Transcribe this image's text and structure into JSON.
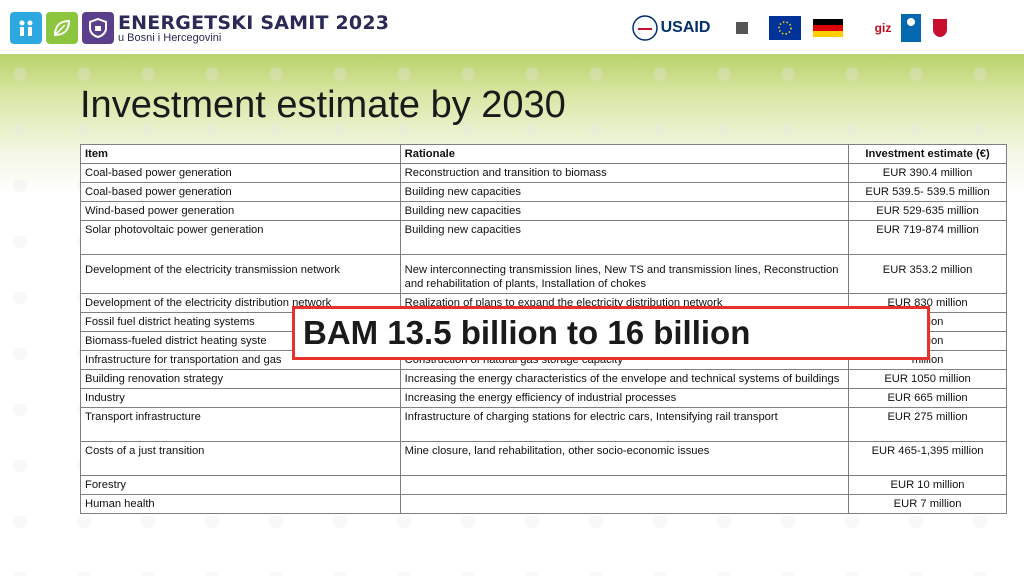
{
  "header": {
    "event_title": "ENERGETSKI SAMIT",
    "event_year": "2023",
    "event_subtitle": "u Bosni i Hercegovini",
    "partners": [
      {
        "name": "USAID",
        "text": "USAID",
        "icon": "usaid-logo-icon",
        "color": "#c8102e"
      },
      {
        "name": "british-embassy",
        "text": "British Embassy Sarajevo",
        "icon": "crest-icon"
      },
      {
        "name": "eu",
        "text": "European Union",
        "icon": "eu-flag-icon",
        "color": "#003399"
      },
      {
        "name": "german-cooperation",
        "text": "german cooperation",
        "icon": "german-flag-icon"
      },
      {
        "name": "giz",
        "text": "giz",
        "icon": "giz-logo-icon"
      },
      {
        "name": "undp",
        "text": "UNDP",
        "icon": "undp-logo-icon",
        "color": "#0468b1"
      },
      {
        "name": "ministry-czech",
        "text": "Ministry of Foreign Affairs of the Czech Republic",
        "icon": "lion-emblem-icon"
      }
    ]
  },
  "slide": {
    "title": "Investment estimate by 2030"
  },
  "table": {
    "headers": [
      "Item",
      "Rationale",
      "Investment estimate (€)"
    ],
    "rows": [
      {
        "item": "Coal-based power generation",
        "rationale": "Reconstruction and transition to biomass",
        "estimate": "EUR 390.4  million"
      },
      {
        "item": "Coal-based power generation",
        "rationale": "Building new capacities",
        "estimate": "EUR 539.5- 539.5  million"
      },
      {
        "item": "Wind-based power generation",
        "rationale": "Building new capacities",
        "estimate": "EUR 529-635 million"
      },
      {
        "item": "Solar photovoltaic power generation",
        "rationale": "Building new capacities",
        "estimate": "EUR 719-874 million"
      },
      {
        "item": "Development of the electricity transmission network",
        "rationale": "New interconnecting transmission lines, New TS and transmission lines, Reconstruction and rehabilitation of plants, Installation of chokes",
        "estimate": "EUR 353.2  million"
      },
      {
        "item": "Development of the electricity distribution network",
        "rationale": "Realization of plans to expand the electricity distribution network",
        "estimate": "EUR 830  million"
      },
      {
        "item": "Fossil fuel district heating systems",
        "rationale": "",
        "estimate": "million"
      },
      {
        "item": "Biomass-fueled district heating syste",
        "rationale": "",
        "estimate": "million"
      },
      {
        "item": "Infrastructure for transportation and gas",
        "rationale": "Construction of natural gas storage capacity",
        "estimate": "million"
      },
      {
        "item": "Building renovation strategy",
        "rationale": "Increasing the energy characteristics of the envelope and technical systems of buildings",
        "estimate": "EUR 1050  million"
      },
      {
        "item": "Industry",
        "rationale": "Increasing the energy efficiency of industrial processes",
        "estimate": "EUR 665  million"
      },
      {
        "item": "Transport infrastructure",
        "rationale": "Infrastructure of charging stations for electric cars, Intensifying rail transport",
        "estimate": "EUR 275  million"
      },
      {
        "item": "Costs of a just transition",
        "rationale": "Mine closure, land rehabilitation, other socio-economic issues",
        "estimate": "EUR 465-1,395  million"
      },
      {
        "item": "Forestry",
        "rationale": "",
        "estimate": "EUR 10  million"
      },
      {
        "item": "Human health",
        "rationale": "",
        "estimate": "EUR 7  million"
      }
    ]
  },
  "overlay": {
    "text": "BAM 13.5 billion to 16 billion",
    "border_color": "#e8312a"
  },
  "colors": {
    "brand_navy": "#2b2a56",
    "header_green": "#b9d26a",
    "tile_colors": [
      "#2ba8e0",
      "#8cc63f",
      "#5b3f8c"
    ]
  }
}
